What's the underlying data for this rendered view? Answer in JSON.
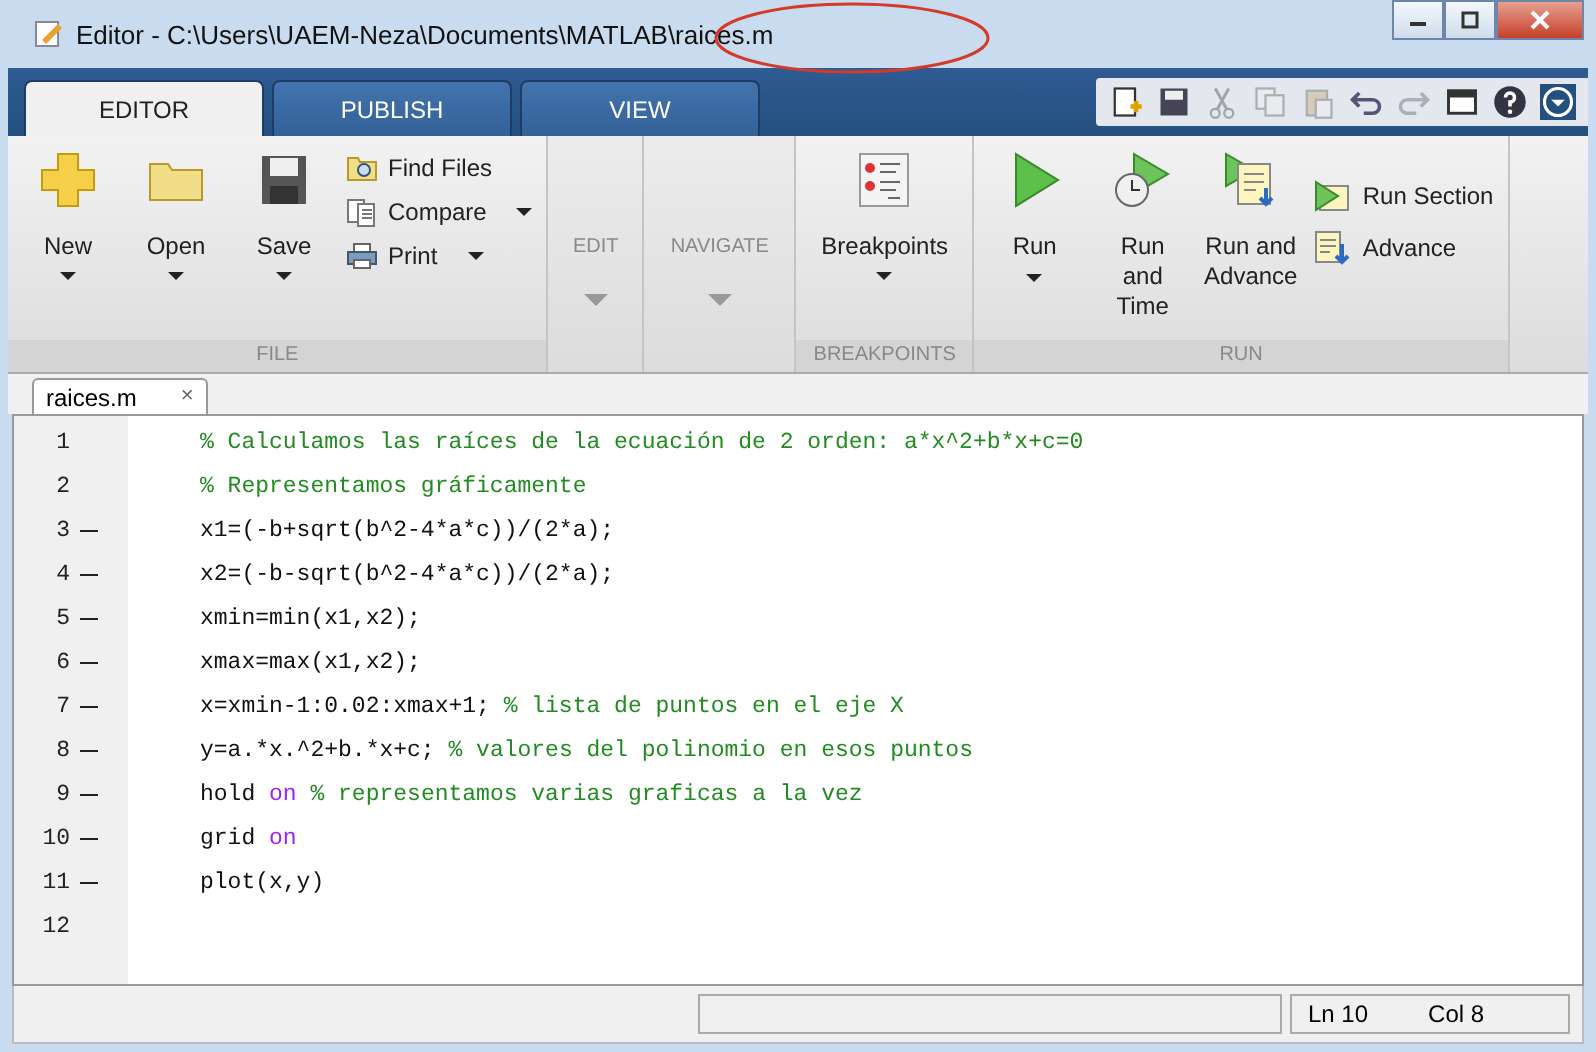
{
  "window": {
    "title": "Editor - C:\\Users\\UAEM-Neza\\Documents\\MATLAB\\raices.m"
  },
  "tabs": [
    {
      "label": "EDITOR",
      "selected": true
    },
    {
      "label": "PUBLISH",
      "selected": false
    },
    {
      "label": "VIEW",
      "selected": false
    }
  ],
  "ribbon": {
    "file": {
      "big_buttons": [
        {
          "label": "New",
          "kind": "new"
        },
        {
          "label": "Open",
          "kind": "open"
        },
        {
          "label": "Save",
          "kind": "save"
        }
      ],
      "small_buttons": [
        {
          "label": "Find Files",
          "kind": "find",
          "dropdown": false
        },
        {
          "label": "Compare",
          "kind": "compare",
          "dropdown": true
        },
        {
          "label": "Print",
          "kind": "print",
          "dropdown": true
        }
      ],
      "group_label": "FILE"
    },
    "collapsed": [
      {
        "label": "EDIT"
      },
      {
        "label": "NAVIGATE"
      }
    ],
    "breakpoints": {
      "button": "Breakpoints",
      "group_label": "BREAKPOINTS"
    },
    "run": {
      "big_buttons": [
        {
          "label": "Run",
          "kind": "run",
          "dropdown": true
        },
        {
          "label": "Run and Time",
          "kind": "time",
          "dropdown": false
        },
        {
          "label": "Run and Advance",
          "kind": "advance",
          "dropdown": false
        }
      ],
      "small_buttons": [
        {
          "label": "Run Section",
          "kind": "section"
        },
        {
          "label": "Advance",
          "kind": "step"
        }
      ],
      "group_label": "RUN"
    }
  },
  "document_tab": {
    "label": "raices.m",
    "close": "×"
  },
  "code_lines": [
    {
      "number": "1",
      "executable": false,
      "segments": [
        {
          "kind": "comment",
          "text": "% Calculamos las raíces de la ecuación de 2 orden: a*x^2+b*x+c=0"
        }
      ]
    },
    {
      "number": "2",
      "executable": false,
      "segments": [
        {
          "kind": "comment",
          "text": "% Representamos gráficamente"
        }
      ]
    },
    {
      "number": "3",
      "executable": true,
      "segments": [
        {
          "kind": "code",
          "text": "x1=(-b+sqrt(b^2-4*a*c))/(2*a);"
        }
      ]
    },
    {
      "number": "4",
      "executable": true,
      "segments": [
        {
          "kind": "code",
          "text": "x2=(-b-sqrt(b^2-4*a*c))/(2*a);"
        }
      ]
    },
    {
      "number": "5",
      "executable": true,
      "segments": [
        {
          "kind": "code",
          "text": "xmin=min(x1,x2);"
        }
      ]
    },
    {
      "number": "6",
      "executable": true,
      "segments": [
        {
          "kind": "code",
          "text": "xmax=max(x1,x2);"
        }
      ]
    },
    {
      "number": "7",
      "executable": true,
      "segments": [
        {
          "kind": "code",
          "text": "x=xmin-1:0.02:xmax+1; "
        },
        {
          "kind": "comment",
          "text": "% lista de puntos en el eje X"
        }
      ]
    },
    {
      "number": "8",
      "executable": true,
      "segments": [
        {
          "kind": "code",
          "text": "y=a.*x.^2+b.*x+c; "
        },
        {
          "kind": "comment",
          "text": "% valores del polinomio en esos puntos"
        }
      ]
    },
    {
      "number": "9",
      "executable": true,
      "segments": [
        {
          "kind": "code",
          "text": "hold "
        },
        {
          "kind": "keyword",
          "text": "on"
        },
        {
          "kind": "comment",
          "text": " % representamos varias graficas a la vez"
        }
      ]
    },
    {
      "number": "10",
      "executable": true,
      "segments": [
        {
          "kind": "code",
          "text": "grid "
        },
        {
          "kind": "keyword",
          "text": "on"
        }
      ]
    },
    {
      "number": "11",
      "executable": true,
      "segments": [
        {
          "kind": "code",
          "text": "plot(x,y)"
        }
      ]
    },
    {
      "number": "12",
      "executable": false
    }
  ],
  "status_bar": {
    "line": "Ln  10",
    "column": "Col  8"
  }
}
